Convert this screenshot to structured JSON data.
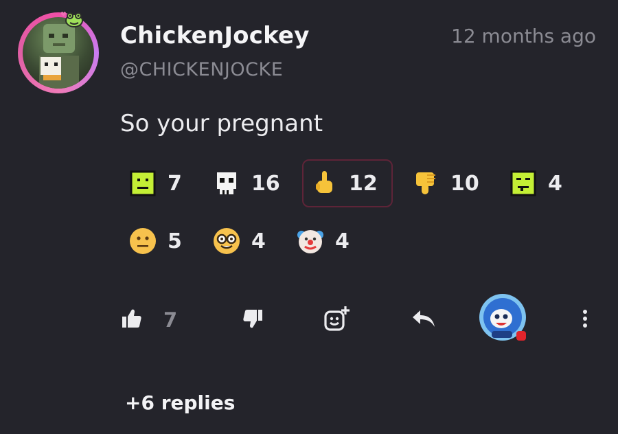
{
  "comment": {
    "username": "ChickenJockey",
    "handle": "@CHICKENJOCKE",
    "timestamp": "12 months ago",
    "text": "So your pregnant"
  },
  "reactions": [
    {
      "icon": "neutral-block-face-icon",
      "count": "7"
    },
    {
      "icon": "skull-icon",
      "count": "16",
      "selected": false
    },
    {
      "icon": "middle-finger-icon",
      "count": "12",
      "selected": true
    },
    {
      "icon": "thumbs-down-icon",
      "count": "10"
    },
    {
      "icon": "sick-block-face-icon",
      "count": "4"
    },
    {
      "icon": "neutral-face-emoji-icon",
      "count": "5"
    },
    {
      "icon": "nerd-face-emoji-icon",
      "count": "4"
    },
    {
      "icon": "clown-face-emoji-icon",
      "count": "4"
    }
  ],
  "actions": {
    "like_count": "7",
    "like_icon": "thumbs-up-icon",
    "dislike_icon": "thumbs-down-icon",
    "add_reaction_icon": "add-reaction-icon",
    "reply_icon": "reply-arrow-icon",
    "more_icon": "more-vertical-icon"
  },
  "replies_label": "+6 replies",
  "colors": {
    "background": "#24242b",
    "text": "#f1f1f3",
    "muted": "#8b8b93",
    "selected_border": "#5e2438",
    "avatar_ring": "#f04fa7"
  }
}
